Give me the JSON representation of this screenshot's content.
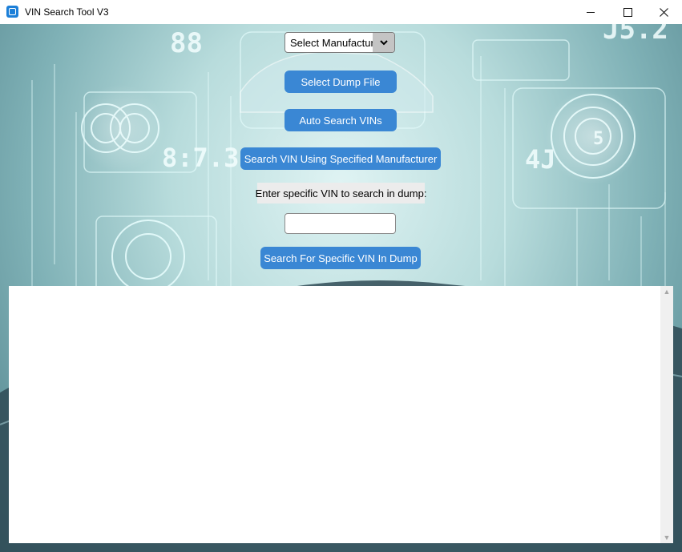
{
  "window": {
    "title": "VIN Search Tool V3"
  },
  "controls": {
    "manufacturer_select": {
      "value": "Select Manufacturer"
    },
    "select_dump_button": "Select Dump File",
    "auto_search_button": "Auto Search VINs",
    "manufacturer_search_button": "Search VIN Using Specified Manufacturer",
    "vin_prompt": "Enter specific VIN to search in dump:",
    "vin_input_value": "",
    "specific_search_button": "Search For Specific VIN In Dump"
  },
  "output": {
    "text": ""
  },
  "icons": {
    "app": "app-window-icon",
    "dropdown": "chevron-down-icon",
    "minimize": "minimize-icon",
    "maximize": "maximize-icon",
    "close": "close-icon"
  },
  "colors": {
    "button": "#3a87d4",
    "button_text": "#ffffff",
    "label_bg": "#ececec",
    "background_tint": "#b8dcdc"
  }
}
